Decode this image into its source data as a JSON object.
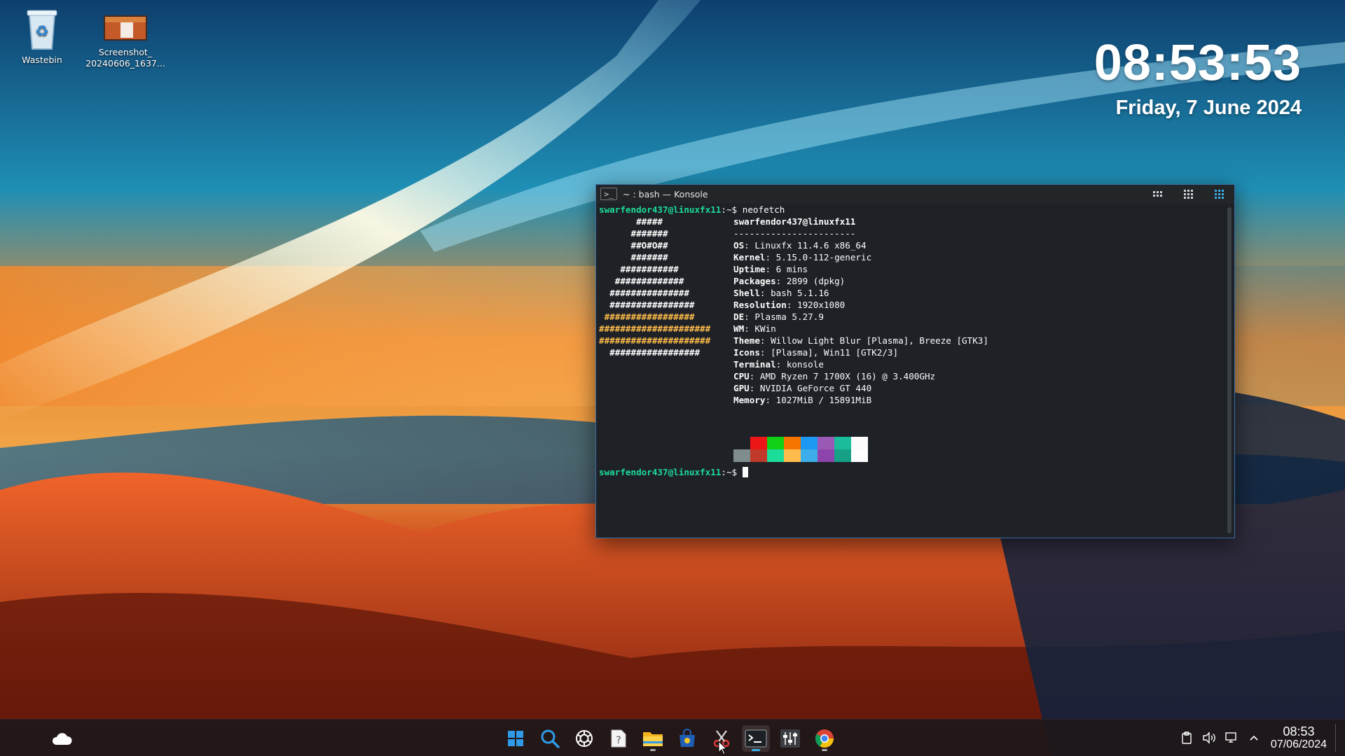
{
  "desktop": {
    "icons": [
      {
        "label": "Wastebin"
      },
      {
        "label": "Screenshot_\n20240606_1637..."
      }
    ]
  },
  "clock_widget": {
    "time": "08:53:53",
    "date": "Friday, 7 June 2024"
  },
  "konsole": {
    "title": "~ : bash — Konsole",
    "prompt_user": "swarfendor437@linuxfx11",
    "prompt_suffix": ":~$ ",
    "command": "neofetch",
    "header": "swarfendor437@linuxfx11",
    "separator": "-----------------------",
    "info": [
      {
        "key": "OS",
        "value": "Linuxfx 11.4.6 x86_64"
      },
      {
        "key": "Kernel",
        "value": "5.15.0-112-generic"
      },
      {
        "key": "Uptime",
        "value": "6 mins"
      },
      {
        "key": "Packages",
        "value": "2899 (dpkg)"
      },
      {
        "key": "Shell",
        "value": "bash 5.1.16"
      },
      {
        "key": "Resolution",
        "value": "1920x1080"
      },
      {
        "key": "DE",
        "value": "Plasma 5.27.9"
      },
      {
        "key": "WM",
        "value": "KWin"
      },
      {
        "key": "Theme",
        "value": "Willow Light Blur [Plasma], Breeze [GTK3]"
      },
      {
        "key": "Icons",
        "value": "[Plasma], Win11 [GTK2/3]"
      },
      {
        "key": "Terminal",
        "value": "konsole"
      },
      {
        "key": "CPU",
        "value": "AMD Ryzen 7 1700X (16) @ 3.400GHz"
      },
      {
        "key": "GPU",
        "value": "NVIDIA GeForce GT 440"
      },
      {
        "key": "Memory",
        "value": "1027MiB / 15891MiB"
      }
    ],
    "ascii": [
      "       #####",
      "      #######",
      "      ##O#O##",
      "      #######",
      "    ###########",
      "   #############",
      "  ###############",
      "  ################",
      " #################",
      "#####################",
      "#####################",
      "  #################"
    ],
    "palette_top": [
      "#1e2126",
      "#ed1515",
      "#11d116",
      "#f67400",
      "#1d99f3",
      "#9b59b6",
      "#1abc9c",
      "#fcfcfc"
    ],
    "palette_bottom": [
      "#7f8c8d",
      "#c0392b",
      "#1cdc9a",
      "#fdbc4b",
      "#3daee9",
      "#8e44ad",
      "#16a085",
      "#ffffff"
    ]
  },
  "taskbar": {
    "apps": [
      {
        "name": "start-menu"
      },
      {
        "name": "search"
      },
      {
        "name": "chatgpt"
      },
      {
        "name": "help"
      },
      {
        "name": "file-manager"
      },
      {
        "name": "store"
      },
      {
        "name": "screenshot-tool"
      },
      {
        "name": "konsole"
      },
      {
        "name": "mixer"
      },
      {
        "name": "chrome"
      }
    ],
    "tray": {
      "time": "08:53",
      "date": "07/06/2024"
    }
  }
}
